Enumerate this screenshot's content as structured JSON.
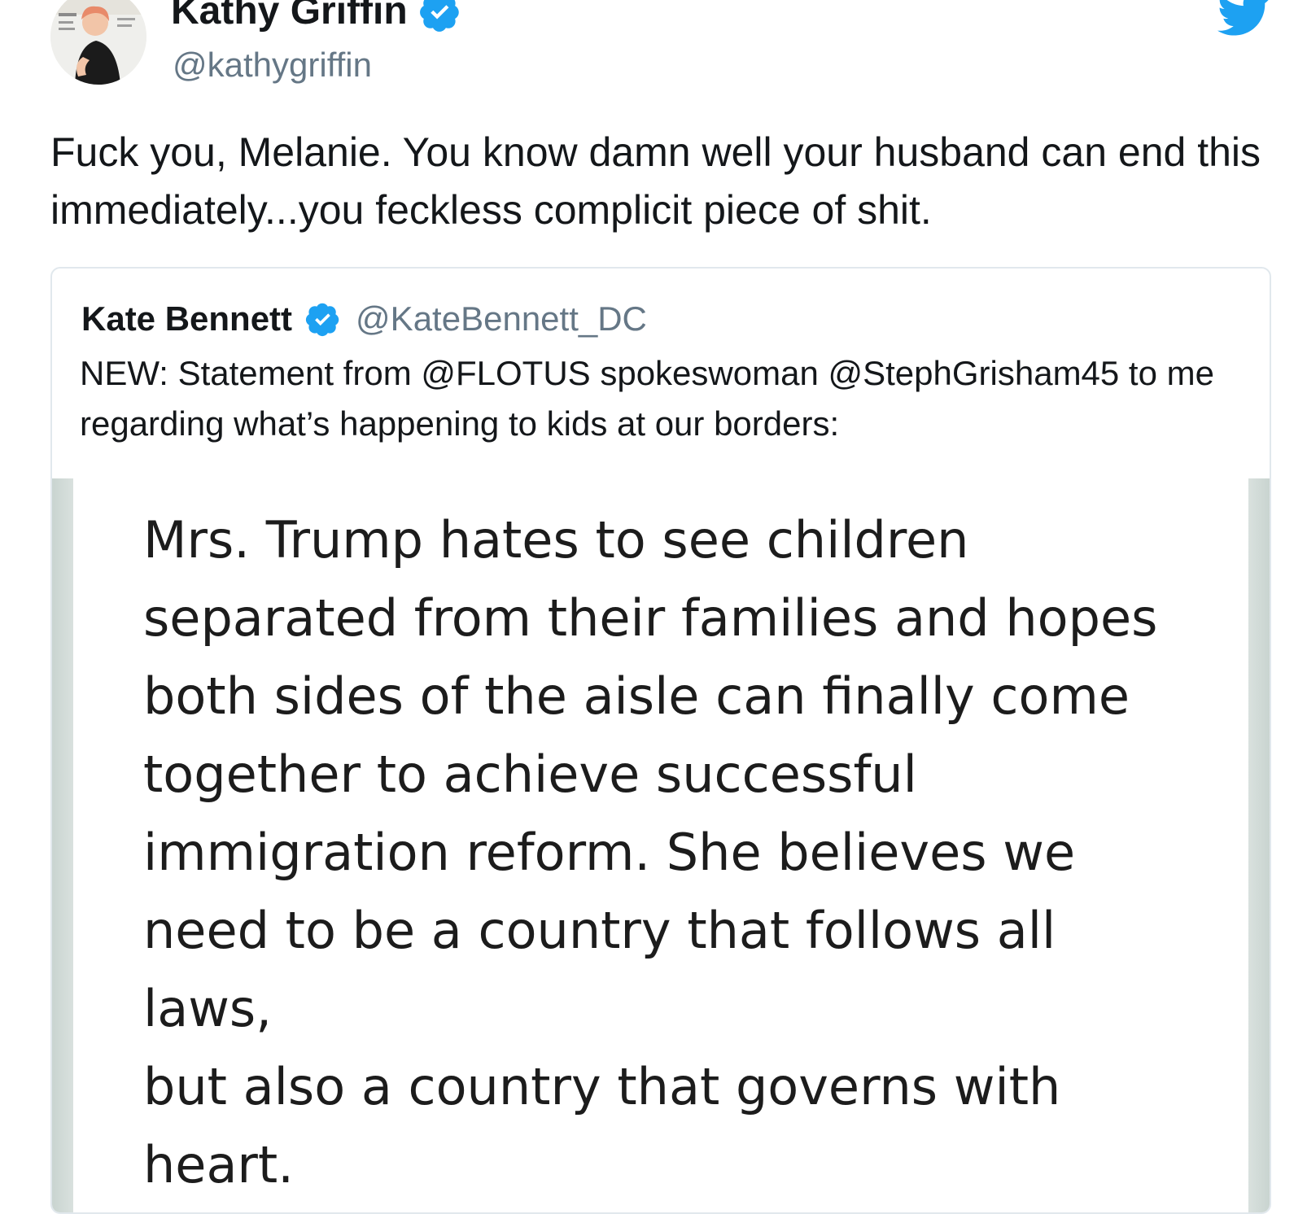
{
  "author": {
    "display_name": "Kathy Griffin",
    "handle": "@kathygriffin",
    "verified": true
  },
  "tweet": {
    "text": "Fuck you, Melanie. You know damn well your husband can end this immediately...you feckless complicit piece of shit."
  },
  "quoted_tweet": {
    "display_name": "Kate Bennett",
    "handle": "@KateBennett_DC",
    "verified": true,
    "text": "NEW: Statement from @FLOTUS spokeswoman @StephGrisham45 to me regarding what’s happening to kids at our borders:",
    "media": {
      "statement_text": "Mrs. Trump hates to see children\nseparated from their families and hopes\nboth sides of the aisle can finally come\ntogether to achieve successful\nimmigration reform.  She believes we\nneed to be a country that follows all laws,\nbut also a country that governs with\nheart."
    }
  },
  "icons": {
    "verified": "verified-badge-icon",
    "brand": "twitter-bird-icon"
  },
  "colors": {
    "brand": "#1da1f2",
    "text": "#14171a",
    "secondary_text": "#657786",
    "border": "#e1e8ed"
  }
}
